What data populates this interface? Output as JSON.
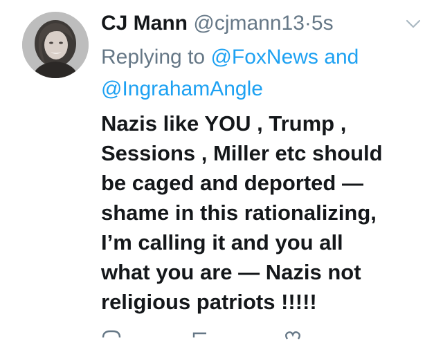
{
  "tweet": {
    "display_name": "CJ Mann",
    "handle": "@cjmann13",
    "separator": "·",
    "timestamp": "5s",
    "reply": {
      "prefix": "Replying to",
      "mention_1": "@FoxNews",
      "conjunction": "and",
      "mention_2": "@IngrahamAngle"
    },
    "text_lines": [
      "Nazis like YOU , Trump ,",
      "Sessions , Miller etc should",
      "be caged and deported —",
      "shame in this rationalizing,",
      "I’m calling it and you all",
      "what you are — Nazis not",
      "religious patriots !!!!!"
    ]
  },
  "icons": {
    "avatar": "avatar",
    "menu": "chevron-down-icon",
    "reply": "reply-icon",
    "retweet": "retweet-icon",
    "like": "heart-icon"
  },
  "colors": {
    "name": "#14171a",
    "secondary": "#657786",
    "link": "#1da1f2",
    "background": "#ffffff"
  }
}
